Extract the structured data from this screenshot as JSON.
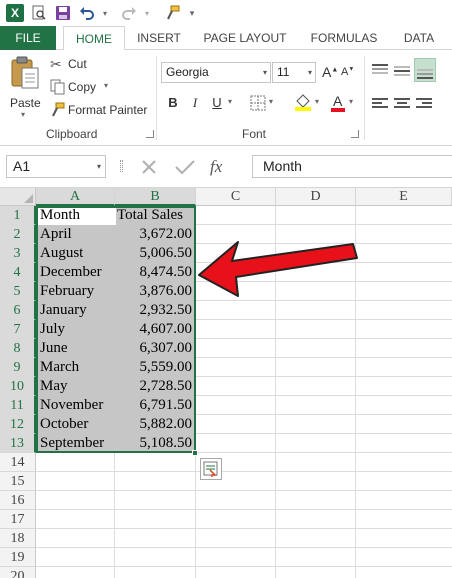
{
  "app": {
    "logo_letter": "X"
  },
  "tabs": [
    "FILE",
    "HOME",
    "INSERT",
    "PAGE LAYOUT",
    "FORMULAS",
    "DATA"
  ],
  "ribbon": {
    "clipboard": {
      "paste": "Paste",
      "cut": "Cut",
      "copy": "Copy",
      "format_painter": "Format Painter",
      "label": "Clipboard"
    },
    "font": {
      "name": "Georgia",
      "size": "11",
      "bold": "B",
      "italic": "I",
      "underline": "U",
      "grow": "A",
      "shrink": "A",
      "font_color_letter": "A",
      "label": "Font"
    },
    "colors": {
      "accent": "#217346",
      "font_color": "#e81123",
      "highlight": "#ffff00"
    }
  },
  "formula_bar": {
    "name_box": "A1",
    "fx": "fx",
    "content": "Month"
  },
  "columns": [
    "A",
    "B",
    "C",
    "D",
    "E"
  ],
  "rows": [
    "1",
    "2",
    "3",
    "4",
    "5",
    "6",
    "7",
    "8",
    "9",
    "10",
    "11",
    "12",
    "13",
    "14",
    "15",
    "16",
    "17",
    "18",
    "19",
    "20"
  ],
  "sheet": {
    "header": {
      "month": "Month",
      "total": "Total Sales"
    },
    "data": [
      {
        "month": "April",
        "total": "3,672.00"
      },
      {
        "month": "August",
        "total": "5,006.50"
      },
      {
        "month": "December",
        "total": "8,474.50"
      },
      {
        "month": "February",
        "total": "3,876.00"
      },
      {
        "month": "January",
        "total": "2,932.50"
      },
      {
        "month": "July",
        "total": "4,607.00"
      },
      {
        "month": "June",
        "total": "6,307.00"
      },
      {
        "month": "March",
        "total": "5,559.00"
      },
      {
        "month": "May",
        "total": "2,728.50"
      },
      {
        "month": "November",
        "total": "6,791.50"
      },
      {
        "month": "October",
        "total": "5,882.00"
      },
      {
        "month": "September",
        "total": "5,108.50"
      }
    ]
  },
  "annotation": {
    "arrow_color": "#e8111a"
  }
}
